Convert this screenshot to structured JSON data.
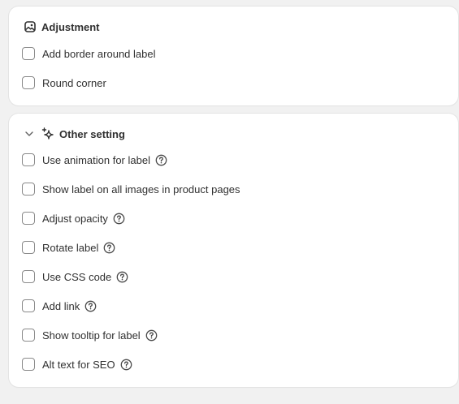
{
  "adjustment": {
    "title": "Adjustment",
    "header_icon": "image-icon",
    "options": [
      {
        "label": "Add border around label",
        "checked": false,
        "help": false
      },
      {
        "label": "Round corner",
        "checked": false,
        "help": false
      }
    ]
  },
  "other": {
    "title": "Other setting",
    "header_icon": "sparkle-icon",
    "collapse_icon": "chevron-down-icon",
    "options": [
      {
        "label": "Use animation for label",
        "checked": false,
        "help": true
      },
      {
        "label": "Show label on all images in product pages",
        "checked": false,
        "help": false
      },
      {
        "label": "Adjust opacity",
        "checked": false,
        "help": true
      },
      {
        "label": "Rotate label",
        "checked": false,
        "help": true
      },
      {
        "label": "Use CSS code",
        "checked": false,
        "help": true
      },
      {
        "label": "Add link",
        "checked": false,
        "help": true
      },
      {
        "label": "Show tooltip for label",
        "checked": false,
        "help": true
      },
      {
        "label": "Alt text for SEO",
        "checked": false,
        "help": true
      }
    ]
  }
}
